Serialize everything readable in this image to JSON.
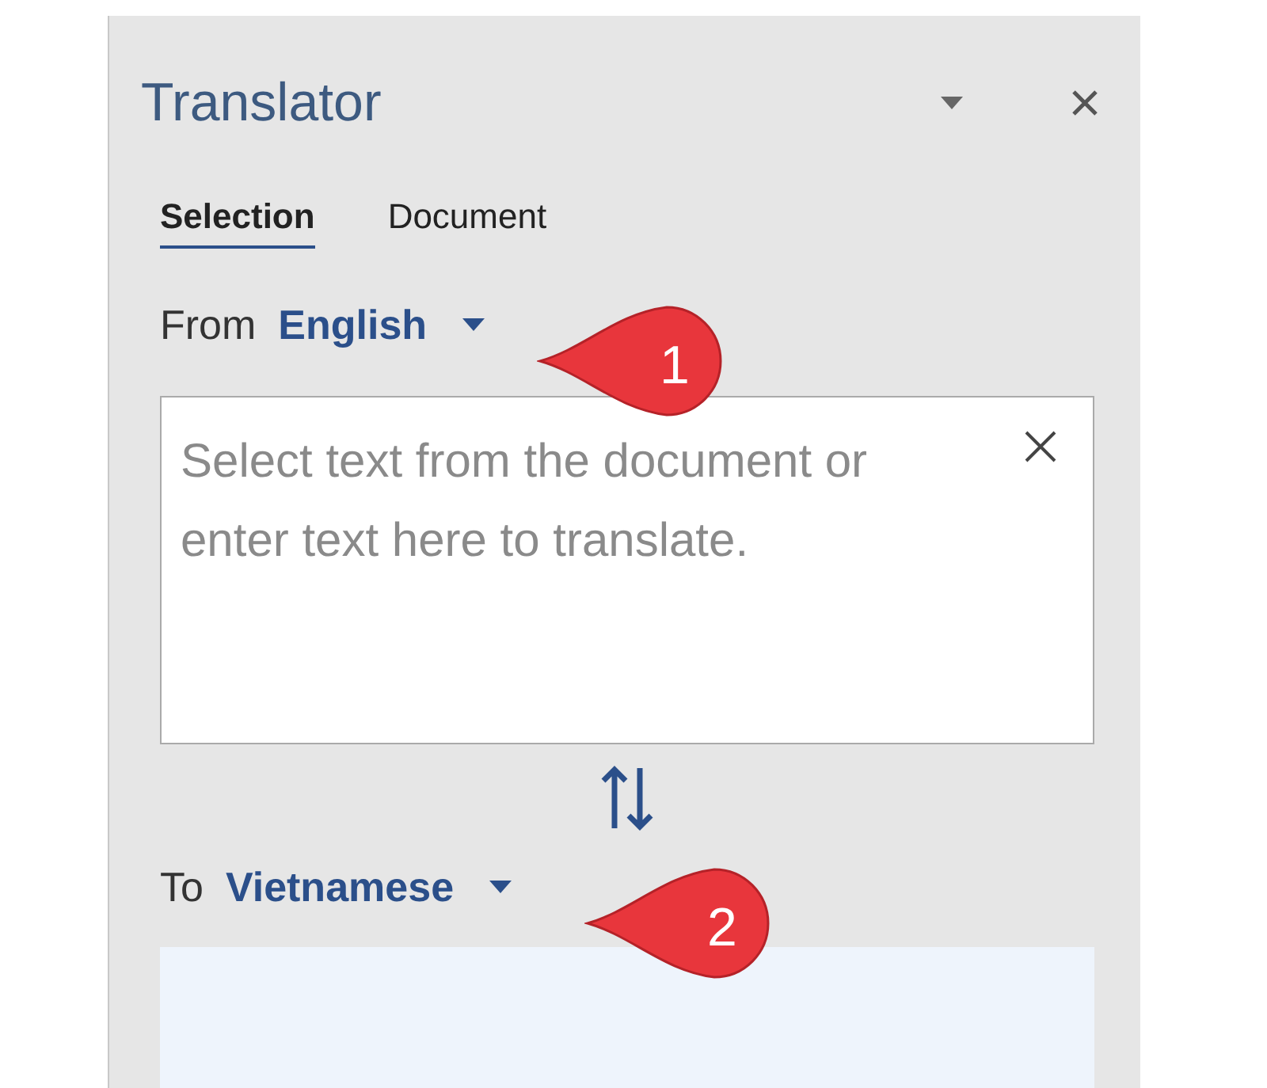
{
  "panel": {
    "title": "Translator"
  },
  "tabs": [
    {
      "label": "Selection",
      "selected": true
    },
    {
      "label": "Document",
      "selected": false
    }
  ],
  "from": {
    "label": "From",
    "language": "English"
  },
  "input": {
    "placeholder": "Select text from the document or enter text here to translate."
  },
  "to": {
    "label": "To",
    "language": "Vietnamese"
  },
  "callouts": [
    {
      "number": "1"
    },
    {
      "number": "2"
    }
  ]
}
